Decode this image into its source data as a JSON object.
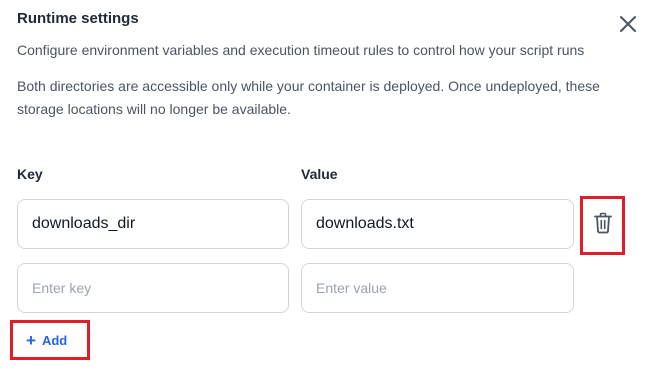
{
  "dialog": {
    "title": "Runtime settings",
    "description": "Configure environment variables and execution timeout rules to control how your script runs",
    "note": "Both directories are accessible only while your container is deployed. Once undeployed, these storage locations will no longer be available."
  },
  "table": {
    "key_header": "Key",
    "value_header": "Value",
    "rows": [
      {
        "key": "downloads_dir",
        "value": "downloads.txt"
      }
    ],
    "new_row": {
      "key_placeholder": "Enter key",
      "value_placeholder": "Enter value"
    }
  },
  "actions": {
    "add_label": "Add",
    "add_icon": "plus-icon",
    "delete_icon": "trash-icon",
    "close_icon": "close-icon"
  },
  "colors": {
    "accent": "#2563eb",
    "highlight": "#e11d2a",
    "border": "#d1d5db"
  }
}
